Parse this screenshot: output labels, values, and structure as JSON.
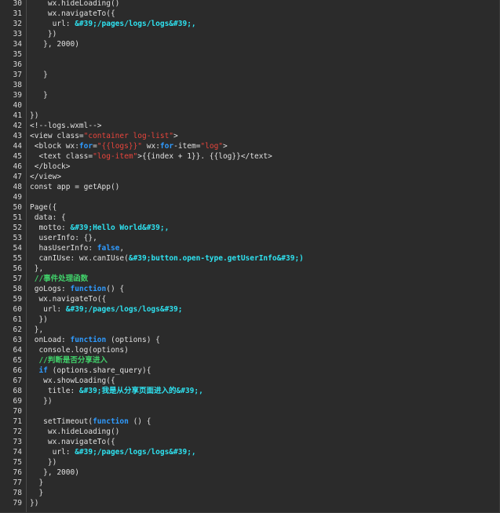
{
  "editor": {
    "lines": [
      {
        "n": "30",
        "segs": [
          {
            "t": "    wx.hideLoading()",
            "c": "pl"
          }
        ]
      },
      {
        "n": "31",
        "segs": [
          {
            "t": "    wx.navigateTo({",
            "c": "pl"
          }
        ]
      },
      {
        "n": "32",
        "segs": [
          {
            "t": "     url: ",
            "c": "pl"
          },
          {
            "t": "&#39;/pages/logs/logs&#39;,",
            "c": "cy"
          }
        ]
      },
      {
        "n": "33",
        "segs": [
          {
            "t": "    })",
            "c": "pl"
          }
        ]
      },
      {
        "n": "34",
        "segs": [
          {
            "t": "   }, 2000)",
            "c": "pl"
          }
        ]
      },
      {
        "n": "35",
        "segs": [
          {
            "t": "",
            "c": "pl"
          }
        ]
      },
      {
        "n": "36",
        "segs": [
          {
            "t": "",
            "c": "pl"
          }
        ]
      },
      {
        "n": "37",
        "segs": [
          {
            "t": "   }",
            "c": "pl"
          }
        ]
      },
      {
        "n": "38",
        "segs": [
          {
            "t": "",
            "c": "pl"
          }
        ]
      },
      {
        "n": "39",
        "segs": [
          {
            "t": "   }",
            "c": "pl"
          }
        ]
      },
      {
        "n": "40",
        "segs": [
          {
            "t": "",
            "c": "pl"
          }
        ]
      },
      {
        "n": "41",
        "segs": [
          {
            "t": "})",
            "c": "pl"
          }
        ]
      },
      {
        "n": "42",
        "segs": [
          {
            "t": "<!--logs.wxml-->",
            "c": "pl"
          }
        ]
      },
      {
        "n": "43",
        "segs": [
          {
            "t": "<view class=",
            "c": "pl"
          },
          {
            "t": "\"container log-list\"",
            "c": "str"
          },
          {
            "t": ">",
            "c": "pl"
          }
        ]
      },
      {
        "n": "44",
        "segs": [
          {
            "t": " <block wx:",
            "c": "pl"
          },
          {
            "t": "for",
            "c": "kw"
          },
          {
            "t": "=",
            "c": "pl"
          },
          {
            "t": "\"{{logs}}\"",
            "c": "str"
          },
          {
            "t": " wx:",
            "c": "pl"
          },
          {
            "t": "for",
            "c": "kw"
          },
          {
            "t": "-item=",
            "c": "pl"
          },
          {
            "t": "\"log\"",
            "c": "str"
          },
          {
            "t": ">",
            "c": "pl"
          }
        ]
      },
      {
        "n": "45",
        "segs": [
          {
            "t": "  <text class=",
            "c": "pl"
          },
          {
            "t": "\"log-item\"",
            "c": "str"
          },
          {
            "t": ">{{index + 1}}. {{log}}</text>",
            "c": "pl"
          }
        ]
      },
      {
        "n": "46",
        "segs": [
          {
            "t": " </block>",
            "c": "pl"
          }
        ]
      },
      {
        "n": "47",
        "segs": [
          {
            "t": "</view>",
            "c": "pl"
          }
        ]
      },
      {
        "n": "48",
        "segs": [
          {
            "t": "const app = getApp()",
            "c": "pl"
          }
        ]
      },
      {
        "n": "49",
        "segs": [
          {
            "t": "",
            "c": "pl"
          }
        ]
      },
      {
        "n": "50",
        "segs": [
          {
            "t": "Page({",
            "c": "pl"
          }
        ]
      },
      {
        "n": "51",
        "segs": [
          {
            "t": " data: {",
            "c": "pl"
          }
        ]
      },
      {
        "n": "52",
        "segs": [
          {
            "t": "  motto: ",
            "c": "pl"
          },
          {
            "t": "&#39;Hello World&#39;,",
            "c": "cy"
          }
        ]
      },
      {
        "n": "53",
        "segs": [
          {
            "t": "  userInfo: {},",
            "c": "pl"
          }
        ]
      },
      {
        "n": "54",
        "segs": [
          {
            "t": "  hasUserInfo: ",
            "c": "pl"
          },
          {
            "t": "false",
            "c": "kw"
          },
          {
            "t": ",",
            "c": "pl"
          }
        ]
      },
      {
        "n": "55",
        "segs": [
          {
            "t": "  canIUse: wx.canIUse(",
            "c": "pl"
          },
          {
            "t": "&#39;button.open-type.getUserInfo&#39;)",
            "c": "cy"
          }
        ]
      },
      {
        "n": "56",
        "segs": [
          {
            "t": " },",
            "c": "pl"
          }
        ]
      },
      {
        "n": "57",
        "segs": [
          {
            "t": " //事件处理函数",
            "c": "cm"
          }
        ]
      },
      {
        "n": "58",
        "segs": [
          {
            "t": " goLogs: ",
            "c": "pl"
          },
          {
            "t": "function",
            "c": "kw"
          },
          {
            "t": "() {",
            "c": "pl"
          }
        ]
      },
      {
        "n": "59",
        "segs": [
          {
            "t": "  wx.navigateTo({",
            "c": "pl"
          }
        ]
      },
      {
        "n": "60",
        "segs": [
          {
            "t": "   url: ",
            "c": "pl"
          },
          {
            "t": "&#39;/pages/logs/logs&#39;",
            "c": "cy"
          }
        ]
      },
      {
        "n": "61",
        "segs": [
          {
            "t": "  })",
            "c": "pl"
          }
        ]
      },
      {
        "n": "62",
        "segs": [
          {
            "t": " },",
            "c": "pl"
          }
        ]
      },
      {
        "n": "63",
        "segs": [
          {
            "t": " onLoad: ",
            "c": "pl"
          },
          {
            "t": "function",
            "c": "kw"
          },
          {
            "t": " (options) {",
            "c": "pl"
          }
        ]
      },
      {
        "n": "64",
        "segs": [
          {
            "t": "  console.log(options)",
            "c": "pl"
          }
        ]
      },
      {
        "n": "65",
        "segs": [
          {
            "t": "  //判断是否分享进入",
            "c": "cm"
          }
        ]
      },
      {
        "n": "66",
        "segs": [
          {
            "t": "  ",
            "c": "pl"
          },
          {
            "t": "if",
            "c": "kw"
          },
          {
            "t": " (options.share_query){",
            "c": "pl"
          }
        ]
      },
      {
        "n": "67",
        "segs": [
          {
            "t": "   wx.showLoading({",
            "c": "pl"
          }
        ]
      },
      {
        "n": "68",
        "segs": [
          {
            "t": "    title: ",
            "c": "pl"
          },
          {
            "t": "&#39;我是从分享页面进入的&#39;,",
            "c": "cy"
          }
        ]
      },
      {
        "n": "69",
        "segs": [
          {
            "t": "   })",
            "c": "pl"
          }
        ]
      },
      {
        "n": "70",
        "segs": [
          {
            "t": "",
            "c": "pl"
          }
        ]
      },
      {
        "n": "71",
        "segs": [
          {
            "t": "   setTimeout(",
            "c": "pl"
          },
          {
            "t": "function",
            "c": "kw"
          },
          {
            "t": " () {",
            "c": "pl"
          }
        ]
      },
      {
        "n": "72",
        "segs": [
          {
            "t": "    wx.hideLoading()",
            "c": "pl"
          }
        ]
      },
      {
        "n": "73",
        "segs": [
          {
            "t": "    wx.navigateTo({",
            "c": "pl"
          }
        ]
      },
      {
        "n": "74",
        "segs": [
          {
            "t": "     url: ",
            "c": "pl"
          },
          {
            "t": "&#39;/pages/logs/logs&#39;,",
            "c": "cy"
          }
        ]
      },
      {
        "n": "75",
        "segs": [
          {
            "t": "    })",
            "c": "pl"
          }
        ]
      },
      {
        "n": "76",
        "segs": [
          {
            "t": "   }, 2000)",
            "c": "pl"
          }
        ]
      },
      {
        "n": "77",
        "segs": [
          {
            "t": "  }",
            "c": "pl"
          }
        ]
      },
      {
        "n": "78",
        "segs": [
          {
            "t": "  }",
            "c": "pl"
          }
        ]
      },
      {
        "n": "79",
        "segs": [
          {
            "t": "})",
            "c": "pl"
          }
        ]
      }
    ]
  },
  "colors": {
    "background": "#2b2b2b",
    "text": "#e0e0e0",
    "keyword": "#2f9bff",
    "string": "#e8453c",
    "single_quoted_string": "#2ee2f0",
    "comment": "#41d06a",
    "line_number": "#d8d8d8"
  }
}
